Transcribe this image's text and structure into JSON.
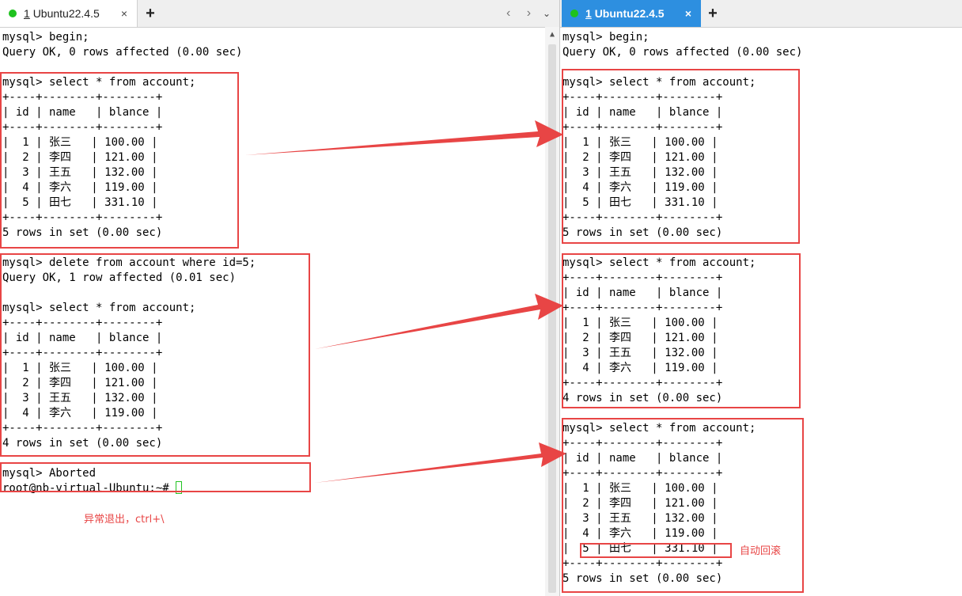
{
  "left_tab": {
    "index": "1",
    "title": "Ubuntu22.4.5",
    "close": "×",
    "add": "+"
  },
  "right_tab": {
    "index": "1",
    "title": "Ubuntu22.4.5",
    "close": "×",
    "add": "+"
  },
  "nav": {
    "arrows": "‹ ›",
    "dropdown": "⌄"
  },
  "left_terminal": {
    "prompt_line": "root@nb-virtual-Ubuntu:~# ",
    "text": "mysql> begin;\nQuery OK, 0 rows affected (0.00 sec)\n\nmysql> select * from account;\n+----+--------+--------+\n| id | name   | blance |\n+----+--------+--------+\n|  1 | 张三   | 100.00 |\n|  2 | 李四   | 121.00 |\n|  3 | 王五   | 132.00 |\n|  4 | 李六   | 119.00 |\n|  5 | 田七   | 331.10 |\n+----+--------+--------+\n5 rows in set (0.00 sec)\n\nmysql> delete from account where id=5;\nQuery OK, 1 row affected (0.01 sec)\n\nmysql> select * from account;\n+----+--------+--------+\n| id | name   | blance |\n+----+--------+--------+\n|  1 | 张三   | 100.00 |\n|  2 | 李四   | 121.00 |\n|  3 | 王五   | 132.00 |\n|  4 | 李六   | 119.00 |\n+----+--------+--------+\n4 rows in set (0.00 sec)\n\nmysql> Aborted"
  },
  "right_terminal": {
    "text": "mysql> begin;\nQuery OK, 0 rows affected (0.00 sec)\n\nmysql> select * from account;\n+----+--------+--------+\n| id | name   | blance |\n+----+--------+--------+\n|  1 | 张三   | 100.00 |\n|  2 | 李四   | 121.00 |\n|  3 | 王五   | 132.00 |\n|  4 | 李六   | 119.00 |\n|  5 | 田七   | 331.10 |\n+----+--------+--------+\n5 rows in set (0.00 sec)\n\nmysql> select * from account;\n+----+--------+--------+\n| id | name   | blance |\n+----+--------+--------+\n|  1 | 张三   | 100.00 |\n|  2 | 李四   | 121.00 |\n|  3 | 王五   | 132.00 |\n|  4 | 李六   | 119.00 |\n+----+--------+--------+\n4 rows in set (0.00 sec)\n\nmysql> select * from account;\n+----+--------+--------+\n| id | name   | blance |\n+----+--------+--------+\n|  1 | 张三   | 100.00 |\n|  2 | 李四   | 121.00 |\n|  3 | 王五   | 132.00 |\n|  4 | 李六   | 119.00 |\n|  5 | 田七   | 331.10 |\n+----+--------+--------+\n5 rows in set (0.00 sec)"
  },
  "annotations": {
    "exit_note": "异常退出，ctrl+\\",
    "rollback_note": "自动回滚",
    "color": "#e84545"
  },
  "colors": {
    "active_tab": "#2d8fe0",
    "session_dot": "#1ec21e",
    "cursor": "#22c422"
  }
}
